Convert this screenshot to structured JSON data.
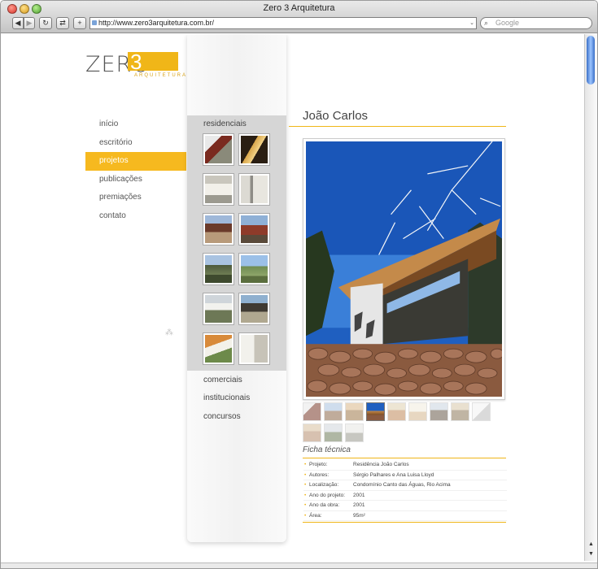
{
  "browser": {
    "title": "Zero 3 Arquitetura",
    "url": "http://www.zero3arquitetura.com.br/",
    "search_placeholder": "Google"
  },
  "logo": {
    "word": "ZERO",
    "number": "3",
    "subtitle": "ARQUITETURA",
    "accent": "#f0b618"
  },
  "nav": {
    "items": [
      {
        "label": "início",
        "active": false
      },
      {
        "label": "escritório",
        "active": false
      },
      {
        "label": "projetos",
        "active": true
      },
      {
        "label": "publicações",
        "active": false
      },
      {
        "label": "premiações",
        "active": false
      },
      {
        "label": "contato",
        "active": false
      }
    ]
  },
  "categories": {
    "residenciais": "residenciais",
    "comerciais": "comerciais",
    "institucionais": "institucionais",
    "concursos": "concursos"
  },
  "project": {
    "title": "João Carlos",
    "ficha_title": "Ficha técnica",
    "ficha": [
      {
        "key": "Projeto:",
        "value": "Residência João Carlos"
      },
      {
        "key": "Autores:",
        "value": "Sérgio Palhares e Ana Luisa Lloyd"
      },
      {
        "key": "Localização:",
        "value": "Condomínio Canto das Águas, Rio Acima"
      },
      {
        "key": "Ano do projeto:",
        "value": "2001"
      },
      {
        "key": "Ano da obra:",
        "value": "2001"
      },
      {
        "key": "Área:",
        "value": "95m²"
      }
    ]
  },
  "colors": {
    "accent": "#f6b91f",
    "panel_gray": "#d6d6d6",
    "text": "#555555"
  }
}
